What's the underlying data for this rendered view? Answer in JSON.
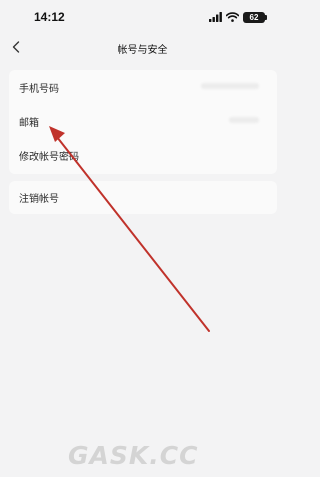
{
  "status_bar": {
    "time": "14:12",
    "battery": "62",
    "icons": [
      "signal-icon",
      "wifi-icon",
      "battery-icon"
    ]
  },
  "nav": {
    "back_icon": "chevron-left-icon",
    "title": "帐号与安全"
  },
  "settings": {
    "account_group": [
      {
        "label": "手机号码"
      },
      {
        "label": "邮箱"
      },
      {
        "label": "修改帐号密码"
      }
    ],
    "danger_group": [
      {
        "label": "注销帐号"
      }
    ]
  },
  "annotation": {
    "type": "red-arrow",
    "color": "#c0322b",
    "points_to": "邮箱"
  },
  "watermark": "GASK.CC",
  "colors": {
    "background": "#f3f3f4",
    "card": "#fafafa",
    "text": "#2a2a2a"
  }
}
